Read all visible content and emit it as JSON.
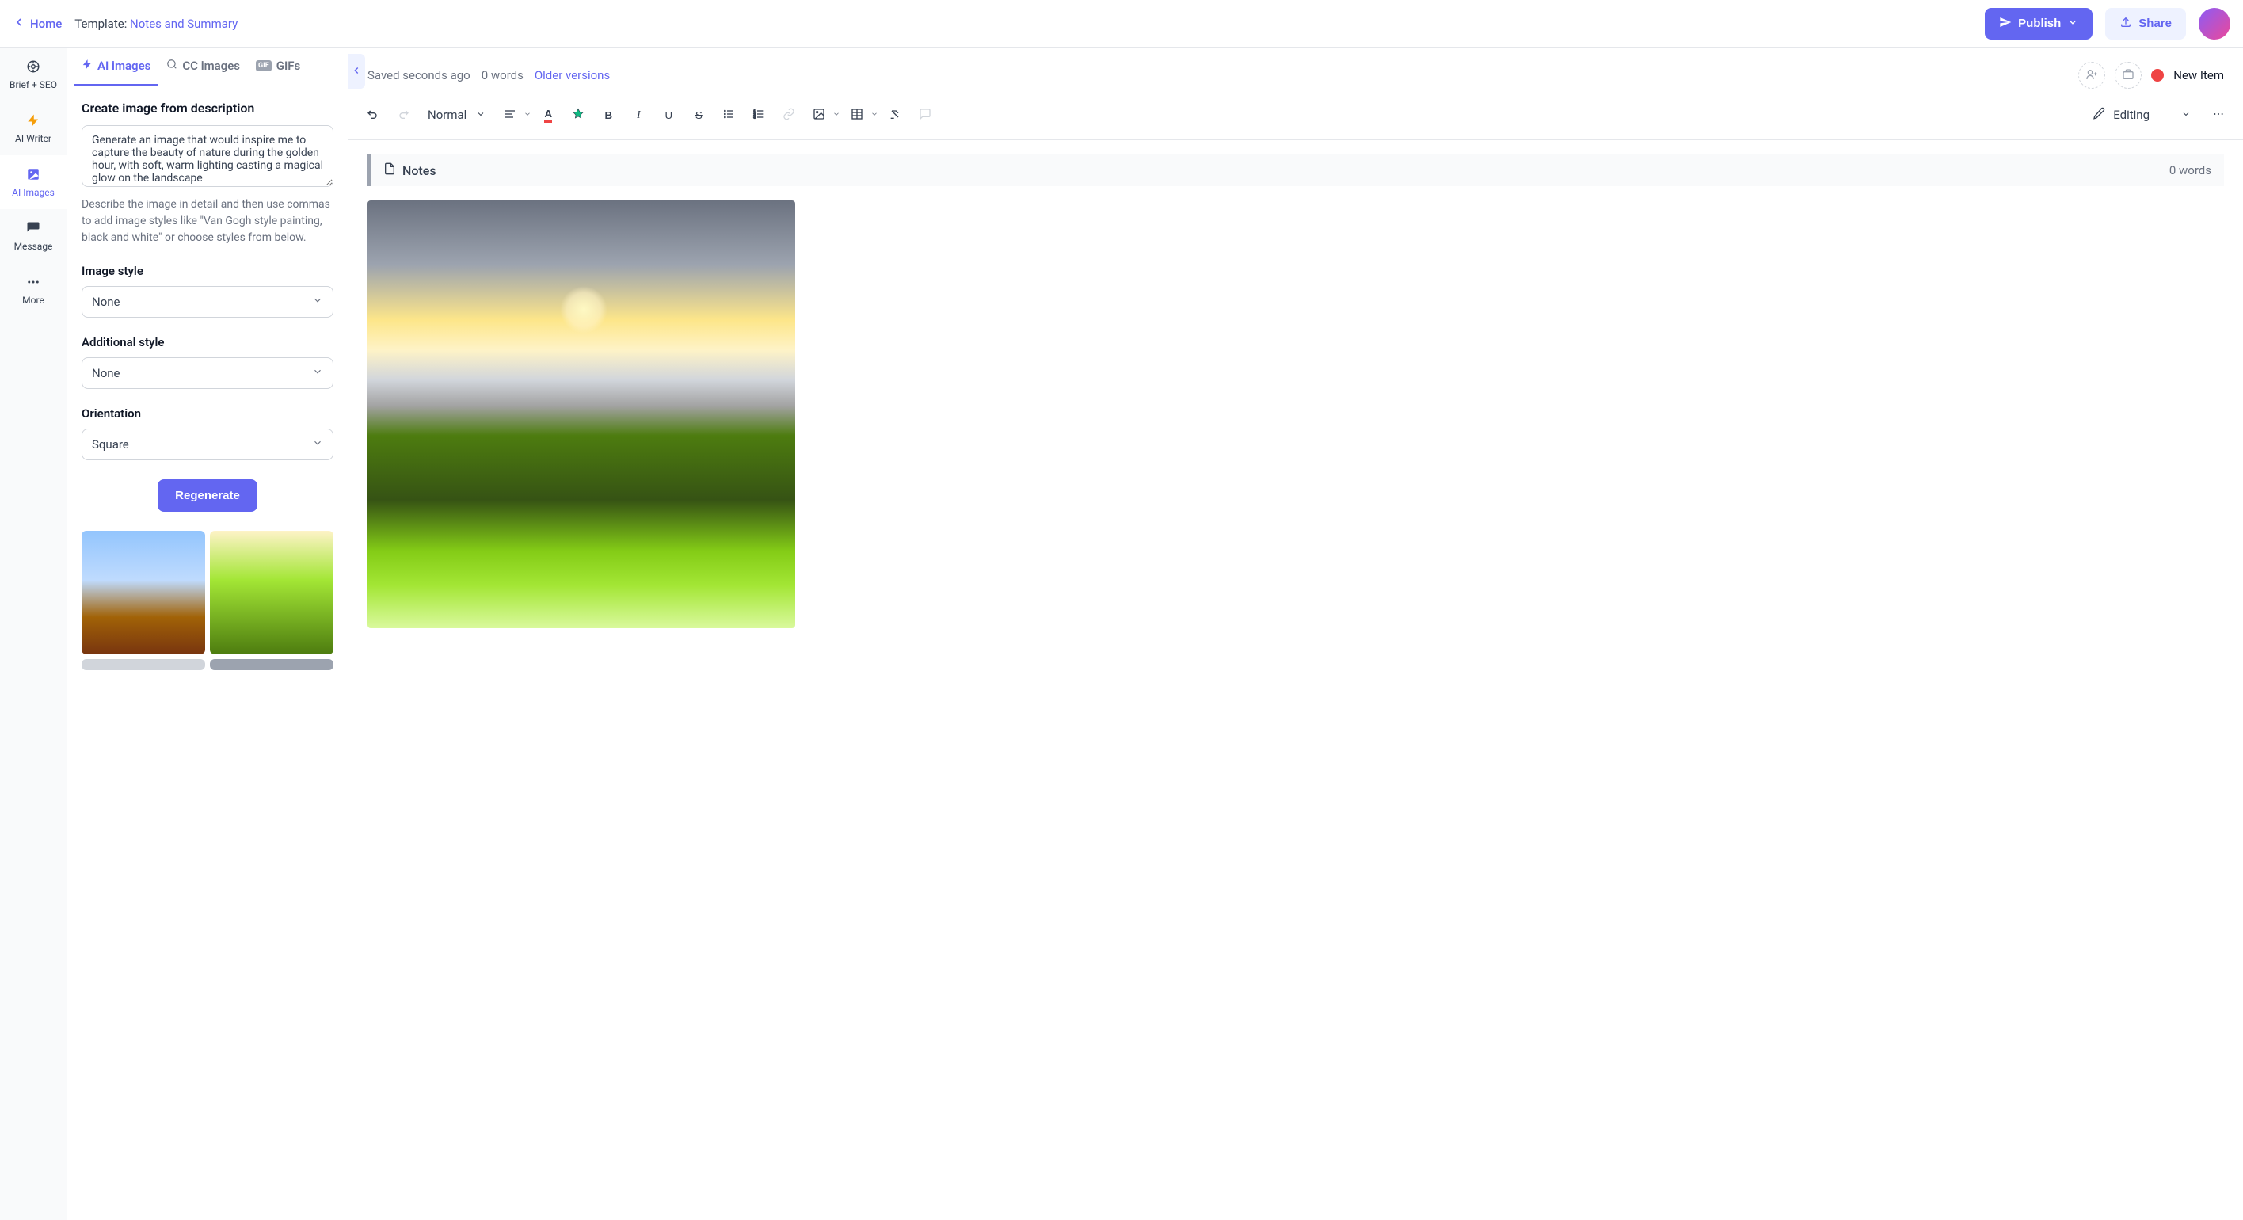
{
  "header": {
    "home_label": "Home",
    "template_prefix": "Template: ",
    "template_name": "Notes and Summary",
    "publish_label": "Publish",
    "share_label": "Share"
  },
  "vnav": {
    "items": [
      {
        "label": "Brief + SEO",
        "icon": "target-icon"
      },
      {
        "label": "AI Writer",
        "icon": "bolt-icon"
      },
      {
        "label": "AI Images",
        "icon": "image-icon"
      },
      {
        "label": "Message",
        "icon": "chat-icon"
      },
      {
        "label": "More",
        "icon": "dots-icon"
      }
    ],
    "active_index": 2
  },
  "tabs": {
    "items": [
      {
        "label": "AI images",
        "icon": "bolt-icon"
      },
      {
        "label": "CC images",
        "icon": "search-icon"
      },
      {
        "label": "GIFs",
        "icon": "gif-icon"
      }
    ],
    "active_index": 0
  },
  "panel": {
    "heading": "Create image from description",
    "prompt_value": "Generate an image that would inspire me to capture the beauty of nature during the golden hour, with soft, warm lighting casting a magical glow on the landscape",
    "helper_text": "Describe the image in detail and then use commas to add image styles like \"Van Gogh style painting, black and white\" or choose styles from below.",
    "image_style_label": "Image style",
    "image_style_value": "None",
    "additional_style_label": "Additional style",
    "additional_style_value": "None",
    "orientation_label": "Orientation",
    "orientation_value": "Square",
    "regenerate_label": "Regenerate"
  },
  "editor_meta": {
    "saved_text": "Saved seconds ago",
    "word_count": "0 words",
    "older_versions": "Older versions",
    "status_label": "New Item"
  },
  "toolbar": {
    "style_value": "Normal",
    "mode_value": "Editing"
  },
  "notes_block": {
    "label": "Notes",
    "word_count": "0 words"
  }
}
